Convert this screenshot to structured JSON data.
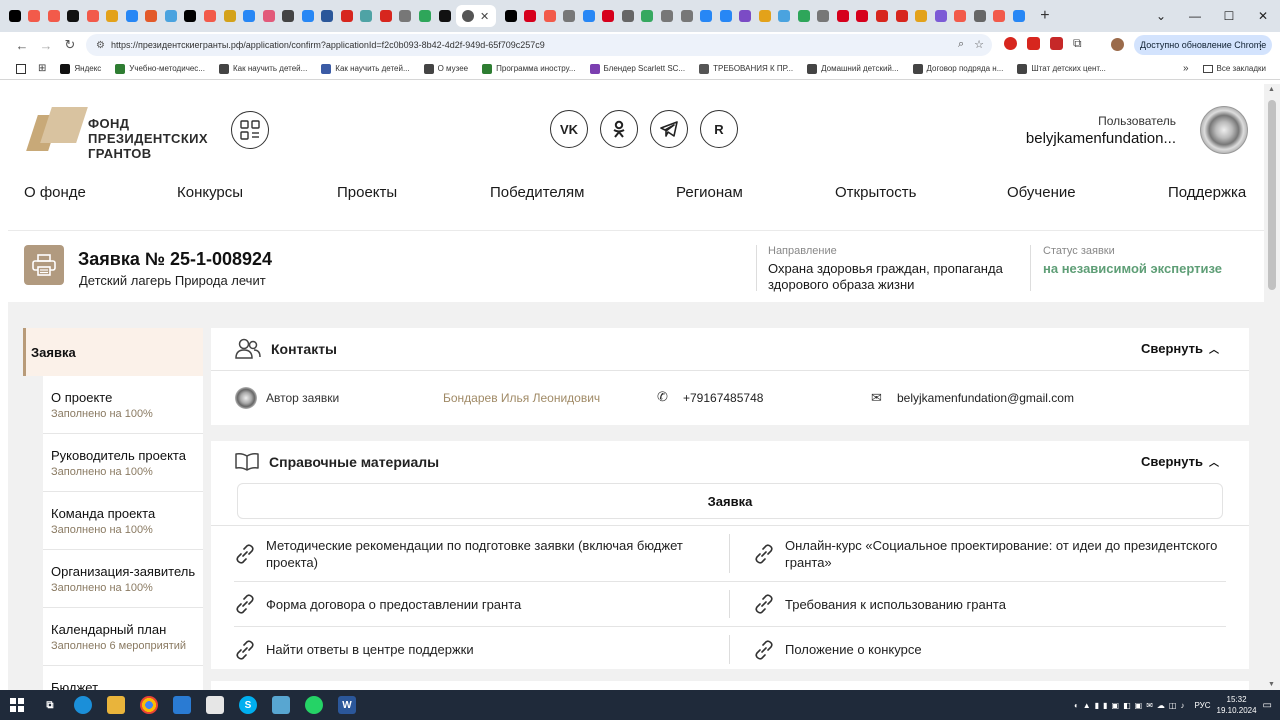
{
  "browser": {
    "tabs": [
      {
        "icon": "plus-tab-icon",
        "color": "#000000"
      },
      {
        "icon": "yandex-tab-icon",
        "color": "#f25a4a"
      },
      {
        "icon": "yandex-tab-icon",
        "color": "#f25a4a"
      },
      {
        "icon": "s-tab-icon",
        "color": "#111111"
      },
      {
        "icon": "yandex-tab-icon",
        "color": "#f25a4a"
      },
      {
        "icon": "folder-tab-icon",
        "color": "#e3a21a"
      },
      {
        "icon": "vk-tab-icon",
        "color": "#2787f5"
      },
      {
        "icon": "mail-tab-icon",
        "color": "#e35a2a"
      },
      {
        "icon": "docs-tab-icon",
        "color": "#4aa3df"
      },
      {
        "icon": "plus-tab-icon",
        "color": "#000000"
      },
      {
        "icon": "yandex-tab-icon",
        "color": "#f25a4a"
      },
      {
        "icon": "pencil-tab-icon",
        "color": "#d4a21a"
      },
      {
        "icon": "vk-tab-icon",
        "color": "#2787f5"
      },
      {
        "icon": "video-tab-icon",
        "color": "#e25a7a"
      },
      {
        "icon": "bank-tab-icon",
        "color": "#444444"
      },
      {
        "icon": "vk-tab-icon",
        "color": "#2787f5"
      },
      {
        "icon": "word-tab-icon",
        "color": "#2b579a"
      },
      {
        "icon": "pdf-tab-icon",
        "color": "#d7261e"
      },
      {
        "icon": "ext-tab-icon",
        "color": "#4fa3a5"
      },
      {
        "icon": "pdf-tab-icon",
        "color": "#d7261e"
      },
      {
        "icon": "globe-tab-icon",
        "color": "#777777"
      },
      {
        "icon": "green-tab-icon",
        "color": "#2ea65a"
      },
      {
        "icon": "d-tab-icon",
        "color": "#111111"
      }
    ],
    "active_tab_index": 23,
    "tabs_after": [
      {
        "icon": "plus-tab-icon",
        "color": "#000000"
      },
      {
        "icon": "hh-tab-icon",
        "color": "#d6001c"
      },
      {
        "icon": "yandex-tab-icon",
        "color": "#f25a4a"
      },
      {
        "icon": "globe-tab-icon",
        "color": "#777777"
      },
      {
        "icon": "vk-tab-icon",
        "color": "#2787f5"
      },
      {
        "icon": "hh-tab-icon",
        "color": "#d6001c"
      },
      {
        "icon": "image-tab-icon",
        "color": "#666666"
      },
      {
        "icon": "leaf-tab-icon",
        "color": "#36a860"
      },
      {
        "icon": "globe-tab-icon",
        "color": "#777777"
      },
      {
        "icon": "globe-tab-icon",
        "color": "#777777"
      },
      {
        "icon": "vk-tab-icon",
        "color": "#2787f5"
      },
      {
        "icon": "vk-tab-icon",
        "color": "#2787f5"
      },
      {
        "icon": "purple-tab-icon",
        "color": "#7b4bc5"
      },
      {
        "icon": "folder-tab-icon",
        "color": "#e3a21a"
      },
      {
        "icon": "docs-tab-icon",
        "color": "#4aa3df"
      },
      {
        "icon": "green-tab-icon",
        "color": "#2ea65a"
      },
      {
        "icon": "globe-tab-icon",
        "color": "#777777"
      },
      {
        "icon": "hh-tab-icon",
        "color": "#d6001c"
      },
      {
        "icon": "hh-tab-icon",
        "color": "#d6001c"
      },
      {
        "icon": "f-tab-icon",
        "color": "#d7261e"
      },
      {
        "icon": "pdf-tab-icon",
        "color": "#d7261e"
      },
      {
        "icon": "folder-tab-icon",
        "color": "#e3a21a"
      },
      {
        "icon": "circle-tab-icon",
        "color": "#7c5bd6"
      },
      {
        "icon": "yandex-tab-icon",
        "color": "#f25a4a"
      },
      {
        "icon": "gray-tab-icon",
        "color": "#666666"
      },
      {
        "icon": "yandex-tab-icon",
        "color": "#f25a4a"
      },
      {
        "icon": "vk-tab-icon",
        "color": "#2787f5"
      }
    ],
    "url": "https://президентскиегранты.рф/application/confirm?applicationId=f2c0b093-8b42-4d2f-949d-65f709c257c9",
    "update_label": "Доступно обновление Chrome",
    "bookmarks": [
      {
        "label": "Яндекс",
        "color": "#111111"
      },
      {
        "label": "Учебно-методичес...",
        "color": "#2e7d32"
      },
      {
        "label": "Как научить детей...",
        "color": "#444444"
      },
      {
        "label": "Как научить детей...",
        "color": "#3b5ba5"
      },
      {
        "label": "О музее",
        "color": "#444444"
      },
      {
        "label": "Программа иностру...",
        "color": "#2e7d32"
      },
      {
        "label": "Блендер Scarlett SC...",
        "color": "#7b3fb0"
      },
      {
        "label": "ТРЕБОВАНИЯ К ПР...",
        "color": "#555555"
      },
      {
        "label": "Домашний детский...",
        "color": "#444444"
      },
      {
        "label": "Договор подряда н...",
        "color": "#444444"
      },
      {
        "label": "Штат детских цент...",
        "color": "#444444"
      }
    ],
    "all_bookmarks_label": "Все закладки"
  },
  "site": {
    "logo_lines": [
      "ФОНД",
      "ПРЕЗИДЕНТСКИХ",
      "ГРАНТОВ"
    ],
    "socials": [
      {
        "name": "vk-social-icon",
        "label": "VK"
      },
      {
        "name": "ok-social-icon",
        "label": "OK"
      },
      {
        "name": "telegram-social-icon",
        "label": ""
      },
      {
        "name": "rutube-social-icon",
        "label": "R"
      }
    ],
    "user_label": "Пользователь",
    "user_name": "belyjkamenfundation...",
    "nav": [
      "О фонде",
      "Конкурсы",
      "Проекты",
      "Победителям",
      "Регионам",
      "Открытость",
      "Обучение",
      "Поддержка"
    ]
  },
  "application": {
    "title": "Заявка № 25-1-008924",
    "subtitle": "Детский лагерь Природа лечит",
    "direction_label": "Направление",
    "direction_value": "Охрана здоровья граждан, пропаганда здорового образа жизни",
    "status_label": "Статус заявки",
    "status_value": "на независимой экспертизе",
    "status_color": "#5e9e76"
  },
  "sidebar": {
    "top": "Заявка",
    "items": [
      {
        "title": "О проекте",
        "sub": "Заполнено на 100%"
      },
      {
        "title": "Руководитель проекта",
        "sub": "Заполнено на 100%"
      },
      {
        "title": "Команда проекта",
        "sub": "Заполнено на 100%"
      },
      {
        "title": "Организация-заявитель",
        "sub": "Заполнено на 100%"
      },
      {
        "title": "Календарный план",
        "sub": "Заполнено 6 мероприятий"
      },
      {
        "title": "Бюджет",
        "sub": ""
      }
    ]
  },
  "contacts": {
    "title": "Контакты",
    "collapse_label": "Свернуть",
    "author_label": "Автор заявки",
    "author_name": "Бондарев Илья Леонидович",
    "phone": "+79167485748",
    "email": "belyjkamenfundation@gmail.com"
  },
  "references": {
    "title": "Справочные материалы",
    "collapse_label": "Свернуть",
    "segment": "Заявка",
    "rows": [
      [
        "Методические рекомендации по подготовке заявки (включая бюджет проекта)",
        "Онлайн-курс «Социальное проектирование: от идеи до президентского гранта»"
      ],
      [
        "Форма договора о предоставлении гранта",
        "Требования к использованию гранта"
      ],
      [
        "Найти ответы в центре поддержки",
        "Положение о конкурсе"
      ]
    ]
  },
  "taskbar": {
    "lang": "РУС",
    "time": "15:32",
    "date": "19.10.2024"
  }
}
